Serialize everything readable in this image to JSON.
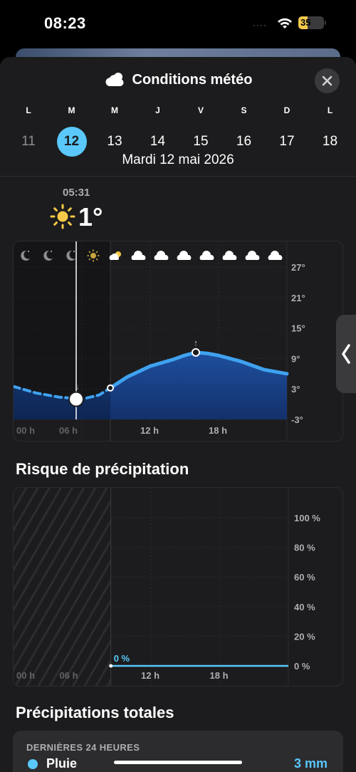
{
  "status": {
    "time": "08:23",
    "battery_percent": "35",
    "battery_level": 0.35,
    "signal_dots": "····"
  },
  "header": {
    "title": "Conditions météo",
    "title_icon": "cloud-sun-icon"
  },
  "week": {
    "days": [
      {
        "letter": "L",
        "num": "11",
        "state": "past"
      },
      {
        "letter": "M",
        "num": "12",
        "state": "selected"
      },
      {
        "letter": "M",
        "num": "13",
        "state": "future"
      },
      {
        "letter": "J",
        "num": "14",
        "state": "future"
      },
      {
        "letter": "V",
        "num": "15",
        "state": "future"
      },
      {
        "letter": "S",
        "num": "16",
        "state": "future"
      },
      {
        "letter": "D",
        "num": "17",
        "state": "future"
      },
      {
        "letter": "L",
        "num": "18",
        "state": "future"
      }
    ],
    "date_label": "Mardi 12 mai 2026"
  },
  "current": {
    "time": "05:31",
    "temp": "1°",
    "icon": "sun-icon"
  },
  "colors": {
    "accent": "#5ac8fa",
    "temp_line": "#3fa2f0",
    "area_top": "#1e4f9e",
    "area_bottom": "#13306a",
    "sun": "#f7c948"
  },
  "chart_data": [
    {
      "type": "area",
      "x_ticks": [
        "00 h",
        "06 h",
        "12 h",
        "18 h"
      ],
      "y_ticks": [
        "27°",
        "21°",
        "15°",
        "9°",
        "3°",
        "-3°"
      ],
      "ylim": [
        -3,
        27
      ],
      "x_hours": [
        0,
        2,
        4,
        6,
        7.5,
        8.5,
        10,
        12,
        14,
        15,
        16,
        17,
        18,
        20,
        22,
        24
      ],
      "temps": [
        3.5,
        2.2,
        1.4,
        1.0,
        1.8,
        3.2,
        5.4,
        7.5,
        8.8,
        9.6,
        10.2,
        10.0,
        9.6,
        8.4,
        6.8,
        6.0
      ],
      "past_until_hour": 8.5,
      "now_hour": 5.5,
      "min": {
        "hour": 5.5,
        "temp": 1
      },
      "max": {
        "hour": 16,
        "temp": 10.2
      },
      "hourly_icons": [
        "moon-icon",
        "moon-icon",
        "moon-icon",
        "sun-icon",
        "partly-cloudy-icon",
        "cloud-icon",
        "cloud-icon",
        "cloud-icon",
        "cloud-icon",
        "cloud-icon",
        "cloud-icon",
        "cloud-icon"
      ]
    },
    {
      "type": "line",
      "title": "Risque de précipitation",
      "x_ticks": [
        "00 h",
        "06 h",
        "12 h",
        "18 h"
      ],
      "y_ticks": [
        "100 %",
        "80 %",
        "60 %",
        "40 %",
        "20 %",
        "0 %"
      ],
      "ylim": [
        0,
        100
      ],
      "past_until_hour": 8.5,
      "x_hours": [
        8.5,
        24
      ],
      "values": [
        0,
        0
      ],
      "value_label": "0 %"
    }
  ],
  "totals": {
    "title": "Précipitations totales",
    "period": "DERNIÈRES 24 HEURES",
    "rain_label": "Pluie",
    "rain_value": "3 mm",
    "rain_level": 1.0
  }
}
